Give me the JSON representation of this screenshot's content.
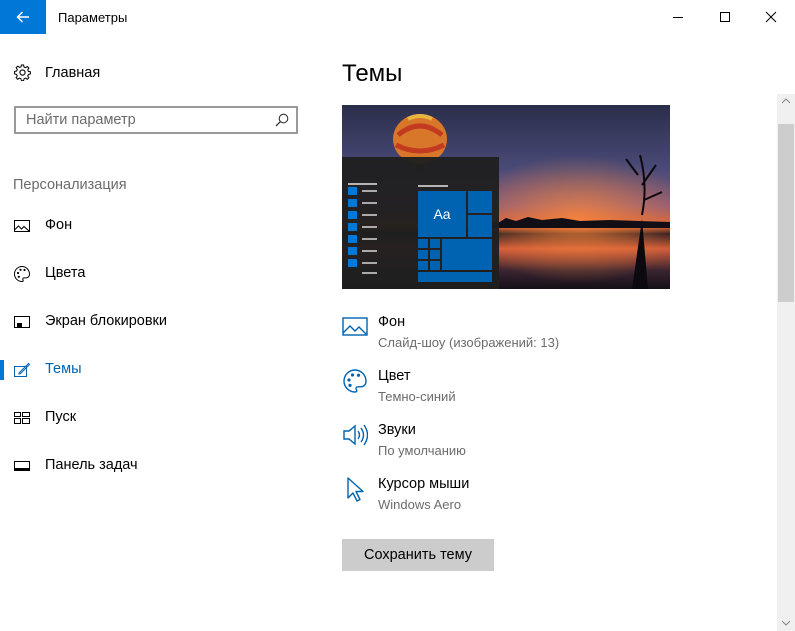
{
  "window": {
    "title": "Параметры",
    "back_icon": "arrow-left-icon",
    "accent": "#0078d7"
  },
  "sidebar": {
    "home_label": "Главная",
    "search_placeholder": "Найти параметр",
    "section_title": "Персонализация",
    "items": [
      {
        "label": "Фон",
        "icon": "picture-icon",
        "active": false
      },
      {
        "label": "Цвета",
        "icon": "palette-icon",
        "active": false
      },
      {
        "label": "Экран блокировки",
        "icon": "lock-screen-icon",
        "active": false
      },
      {
        "label": "Темы",
        "icon": "themes-icon",
        "active": true
      },
      {
        "label": "Пуск",
        "icon": "start-icon",
        "active": false
      },
      {
        "label": "Панель задач",
        "icon": "taskbar-icon",
        "active": false
      }
    ]
  },
  "main": {
    "title": "Темы",
    "preview_tile_text": "Aa",
    "settings": [
      {
        "title": "Фон",
        "value": "Слайд-шоу (изображений: 13)",
        "icon": "picture-icon"
      },
      {
        "title": "Цвет",
        "value": "Темно-синий",
        "icon": "palette-icon"
      },
      {
        "title": "Звуки",
        "value": "По умолчанию",
        "icon": "speaker-icon"
      },
      {
        "title": "Курсор мыши",
        "value": "Windows Aero",
        "icon": "cursor-icon"
      }
    ],
    "save_button": "Сохранить тему"
  }
}
